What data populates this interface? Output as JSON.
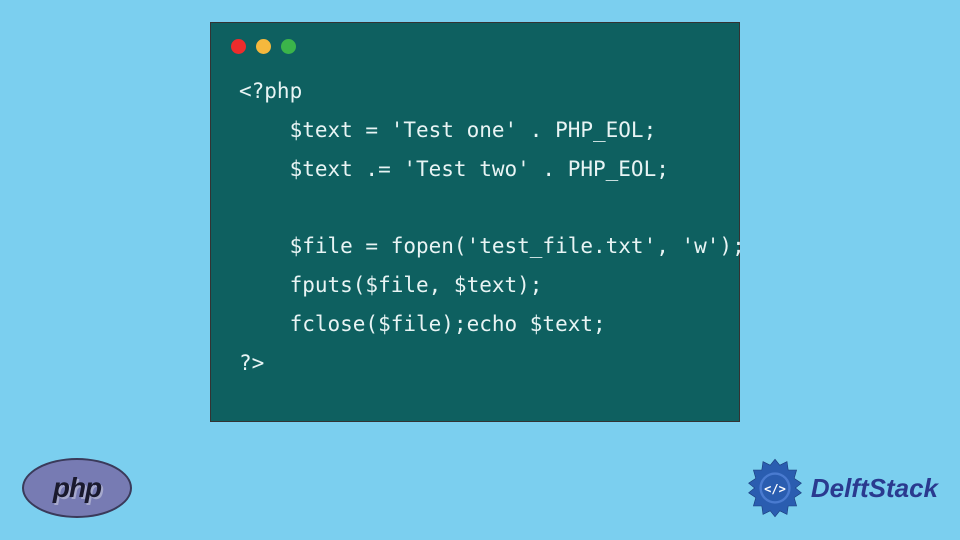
{
  "code": {
    "lines": [
      "<?php",
      "    $text = 'Test one' . PHP_EOL;",
      "    $text .= 'Test two' . PHP_EOL;",
      "",
      "    $file = fopen('test_file.txt', 'w');",
      "    fputs($file, $text);",
      "    fclose($file);echo $text;",
      "?>"
    ]
  },
  "logos": {
    "php": "php",
    "delftstack": "DelftStack"
  },
  "colors": {
    "background": "#7bcfef",
    "window": "#0e6060",
    "red": "#ed2c2c",
    "yellow": "#f5b83d",
    "green": "#3bb44a",
    "php_bg": "#777bb3",
    "ds_blue": "#2a3a8f"
  }
}
